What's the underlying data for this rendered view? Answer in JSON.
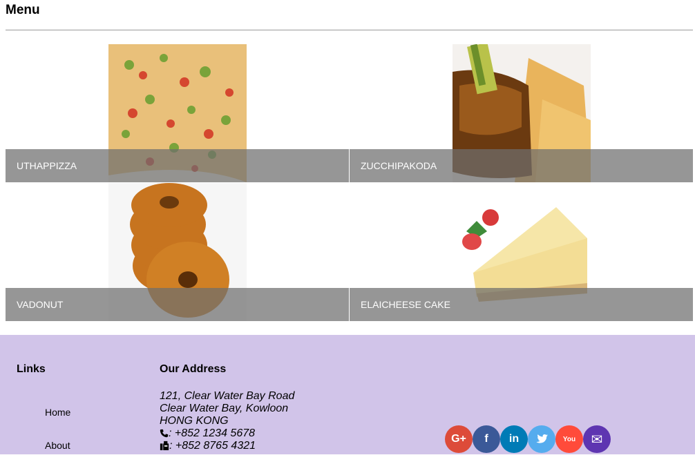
{
  "menu": {
    "title": "Menu",
    "dishes": [
      {
        "name": "UTHAPPIZZA"
      },
      {
        "name": "ZUCCHIPAKODA"
      },
      {
        "name": "VADONUT"
      },
      {
        "name": "ELAICHEESE CAKE"
      }
    ]
  },
  "footer": {
    "links_title": "Links",
    "links": [
      "Home",
      "About"
    ],
    "address_title": "Our Address",
    "address_lines": [
      "121, Clear Water Bay Road",
      "Clear Water Bay, Kowloon",
      "HONG KONG"
    ],
    "phone": ": +852 1234 5678",
    "fax": ": +852 8765 4321",
    "phone_icon": "phone-icon",
    "fax_icon": "fax-icon"
  },
  "social": [
    {
      "name": "google-plus-icon",
      "glyph": "G+",
      "color": "#dd4b39"
    },
    {
      "name": "facebook-icon",
      "glyph": "f",
      "color": "#3b5998"
    },
    {
      "name": "linkedin-icon",
      "glyph": "in",
      "color": "#007bb6"
    },
    {
      "name": "twitter-icon",
      "glyph": "t",
      "color": "#55acee"
    },
    {
      "name": "youtube-icon",
      "glyph": "You",
      "color": "#ff4b3a"
    },
    {
      "name": "mail-icon",
      "glyph": "✉",
      "color": "#5e35b1"
    }
  ],
  "colors": {
    "footer_bg": "#d1c4e9",
    "caption_bg": "rgba(110,110,110,0.72)"
  }
}
